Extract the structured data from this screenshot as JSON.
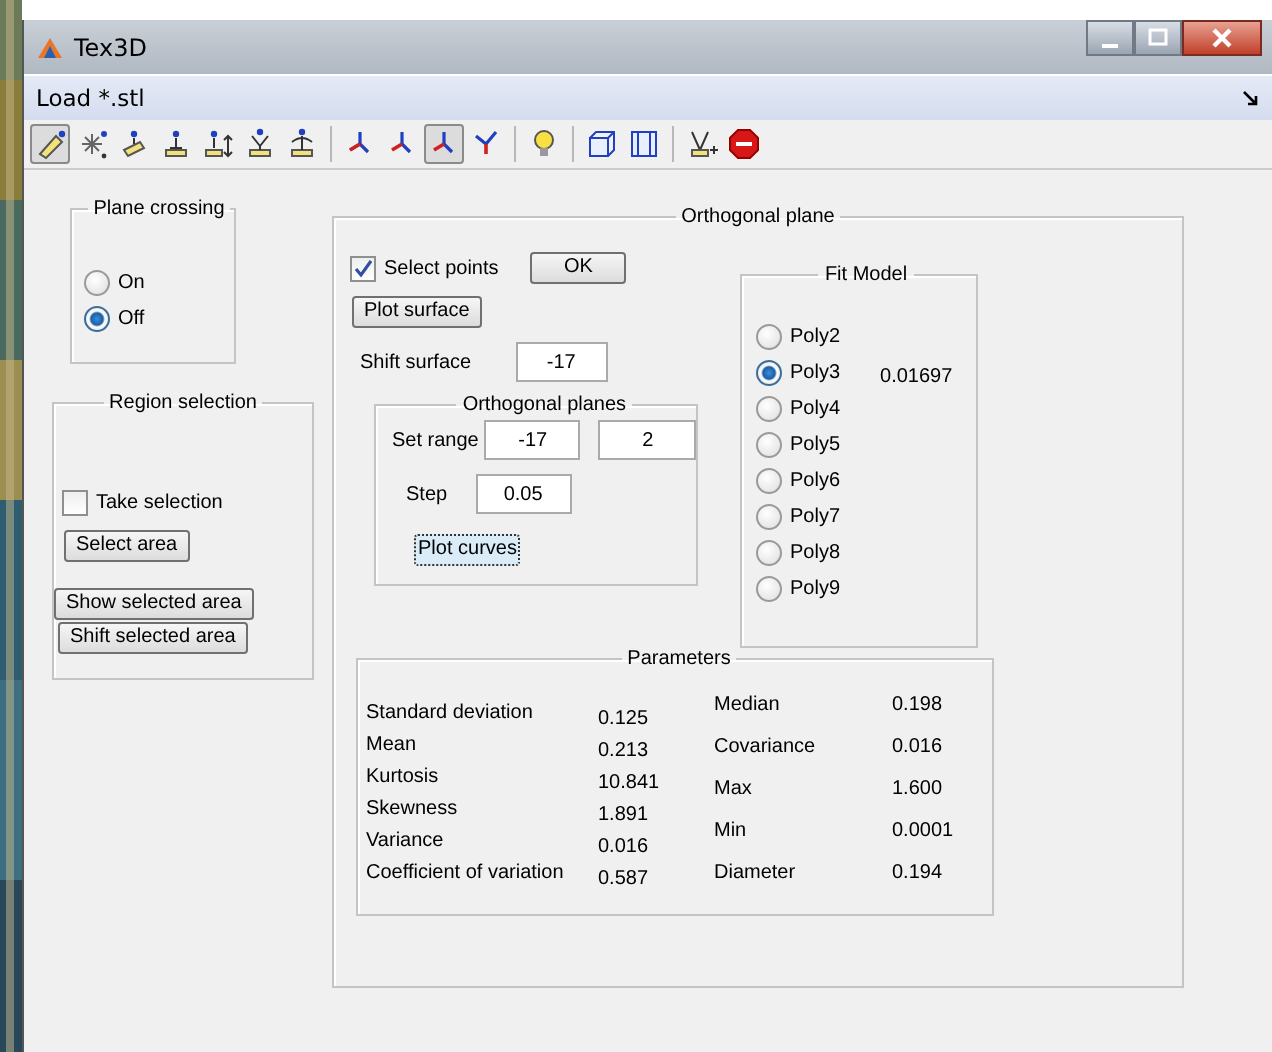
{
  "window": {
    "title": "Tex3D"
  },
  "menu": [
    {
      "label": "Load *.stl"
    }
  ],
  "toolbar": [
    {
      "kind": "tool",
      "selected": true
    },
    {
      "kind": "tool",
      "selected": false
    },
    {
      "kind": "tool",
      "selected": false
    },
    {
      "kind": "tool",
      "selected": false
    },
    {
      "kind": "tool",
      "selected": false
    },
    {
      "kind": "tool",
      "selected": false
    },
    {
      "kind": "tool",
      "selected": false
    },
    {
      "kind": "separator"
    },
    {
      "kind": "tool",
      "selected": false
    },
    {
      "kind": "tool",
      "selected": false
    },
    {
      "kind": "tool",
      "selected": true
    },
    {
      "kind": "tool",
      "selected": false
    },
    {
      "kind": "separator"
    },
    {
      "kind": "tool",
      "selected": false
    },
    {
      "kind": "separator"
    },
    {
      "kind": "tool",
      "selected": false
    },
    {
      "kind": "tool",
      "selected": false
    },
    {
      "kind": "separator"
    },
    {
      "kind": "tool",
      "selected": false
    },
    {
      "kind": "tool",
      "selected": false
    }
  ],
  "plane_crossing": {
    "title": "Plane crossing",
    "options": [
      {
        "label": "On",
        "selected": false
      },
      {
        "label": "Off",
        "selected": true
      }
    ]
  },
  "region_selection": {
    "title": "Region selection",
    "take_selection": {
      "label": "Take selection",
      "checked": false
    },
    "select_button": "Select area",
    "buttons": [
      "Show selected area",
      "Shift selected area"
    ]
  },
  "orthogonal_plane": {
    "title": "Orthogonal plane",
    "select_points": {
      "label": "Select points",
      "checked": true
    },
    "ok_button": "OK",
    "plot_surface_button": "Plot surface",
    "shift_surface": {
      "label": "Shift surface",
      "value": "-17"
    },
    "orthogonal_planes": {
      "title": "Orthogonal planes",
      "set_range": {
        "label": "Set range",
        "from": "-17",
        "to": "2"
      },
      "step": {
        "label": "Step",
        "value": "0.05"
      },
      "plot_curves_button": "Plot curves"
    },
    "fit_model": {
      "title": "Fit Model",
      "options": [
        {
          "label": "Poly2",
          "selected": false
        },
        {
          "label": "Poly3",
          "selected": true,
          "value": "0.01697"
        },
        {
          "label": "Poly4",
          "selected": false
        },
        {
          "label": "Poly5",
          "selected": false
        },
        {
          "label": "Poly6",
          "selected": false
        },
        {
          "label": "Poly7",
          "selected": false
        },
        {
          "label": "Poly8",
          "selected": false
        },
        {
          "label": "Poly9",
          "selected": false
        }
      ]
    },
    "parameters": {
      "title": "Parameters",
      "left": [
        {
          "label": "Standard deviation",
          "value": "0.125"
        },
        {
          "label": "Mean",
          "value": "0.213"
        },
        {
          "label": "Kurtosis",
          "value": "10.841"
        },
        {
          "label": "Skewness",
          "value": "1.891"
        },
        {
          "label": "Variance",
          "value": "0.016"
        },
        {
          "label": "Coefficient of variation",
          "value": "0.587"
        }
      ],
      "right": [
        {
          "label": "Median",
          "value": "0.198"
        },
        {
          "label": "Covariance",
          "value": "0.016"
        },
        {
          "label": "Max",
          "value": "1.600"
        },
        {
          "label": "Min",
          "value": "0.0001"
        },
        {
          "label": "Diameter",
          "value": "0.194"
        }
      ]
    }
  }
}
